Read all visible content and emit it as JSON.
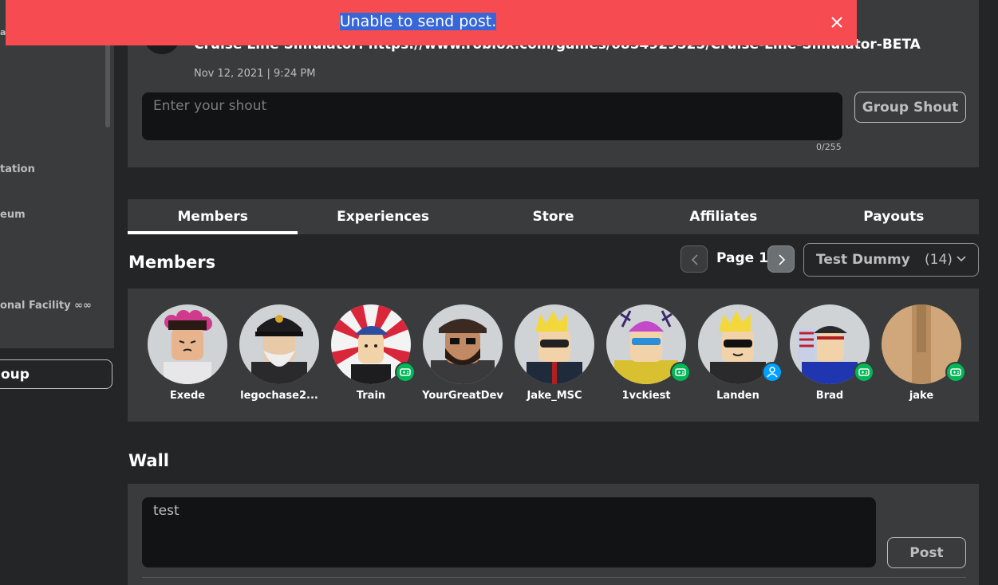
{
  "sidebar": {
    "fragments": [
      "a",
      "tation",
      "eum",
      "onal Facility ∞∞"
    ],
    "button_label": "oup"
  },
  "shout": {
    "text": "Cruise Line Simulator: https://www.roblox.com/games/6854929525/Cruise-Line-Simulator-BETA",
    "date": "Nov 12, 2021 | 9:24 PM",
    "placeholder": "Enter your shout",
    "counter": "0/255",
    "button_label": "Group Shout"
  },
  "tabs": [
    {
      "label": "Members",
      "active": true
    },
    {
      "label": "Experiences",
      "active": false
    },
    {
      "label": "Store",
      "active": false
    },
    {
      "label": "Affiliates",
      "active": false
    },
    {
      "label": "Payouts",
      "active": false
    }
  ],
  "members_section": {
    "title": "Members",
    "page_label": "Page 1",
    "role_name": "Test Dummy",
    "role_count": "(14)",
    "members": [
      {
        "name": "Exede",
        "status": "none"
      },
      {
        "name": "legochase2...",
        "status": "none"
      },
      {
        "name": "Train",
        "status": "in-game"
      },
      {
        "name": "YourGreatDev",
        "status": "none"
      },
      {
        "name": "Jake_MSC",
        "status": "none"
      },
      {
        "name": "1vckiest",
        "status": "in-game"
      },
      {
        "name": "Landen",
        "status": "online"
      },
      {
        "name": "Brad",
        "status": "in-game"
      },
      {
        "name": "jake",
        "status": "in-game"
      }
    ]
  },
  "wall": {
    "title": "Wall",
    "input_value": "test",
    "post_label": "Post"
  },
  "banner": {
    "message": "Unable to send post.",
    "color": "#f74b52"
  }
}
